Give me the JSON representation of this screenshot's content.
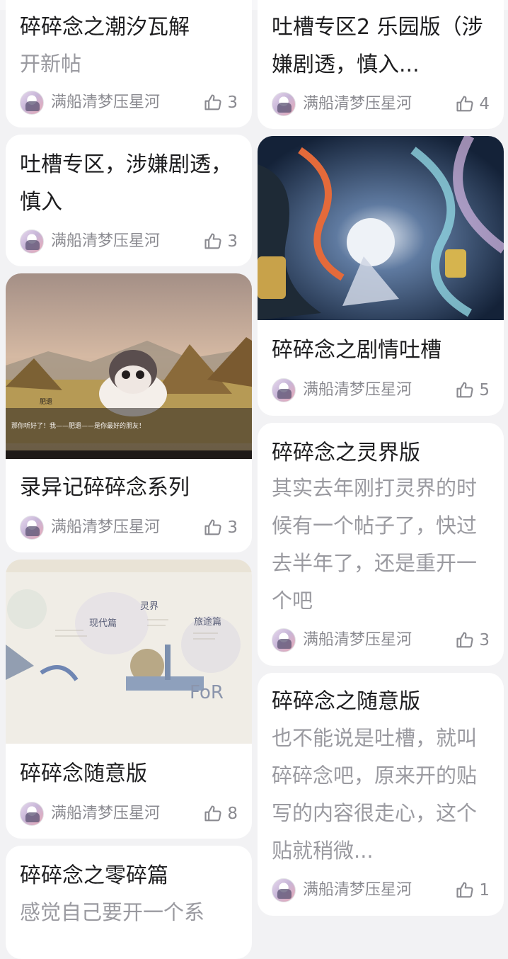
{
  "feed": {
    "cards": [
      {
        "title": "碎碎念之潮汐瓦解",
        "body": "开新帖",
        "author": "满船清梦压星河",
        "likes": "3"
      },
      {
        "title": "吐槽专区2 乐园版（涉嫌剧透，慎入...",
        "body": "",
        "author": "满船清梦压星河",
        "likes": "4"
      },
      {
        "title": "吐槽专区，涉嫌剧透，慎入",
        "body": "",
        "author": "满船清梦压星河",
        "likes": "3"
      },
      {
        "title": "碎碎念之剧情吐槽",
        "body": "",
        "author": "满船清梦压星河",
        "likes": "5",
        "image": "fantasy-artwork"
      },
      {
        "title": "录异记碎碎念系列",
        "body": "",
        "author": "满船清梦压星河",
        "likes": "3",
        "image": "game-screenshot",
        "image_caption_name": "肥遗",
        "image_caption_text": "那你听好了！我——肥遗——是你最好的朋友！"
      },
      {
        "title": "碎碎念之灵界版",
        "body": "其实去年刚打灵界的时候有一个帖子了，快过去半年了，还是重开一个吧",
        "author": "满船清梦压星河",
        "likes": "3"
      },
      {
        "title": "碎碎念随意版",
        "body": "",
        "author": "满船清梦压星河",
        "likes": "8",
        "image": "map-screenshot",
        "image_labels": [
          "现代篇",
          "灵界",
          "旅途篇",
          "FoR"
        ]
      },
      {
        "title": "碎碎念之随意版",
        "body": "也不能说是吐槽，就叫碎碎念吧，原来开的贴写的内容很走心，这个贴就稍微...",
        "author": "满船清梦压星河",
        "likes": "1"
      },
      {
        "title": "碎碎念之零碎篇",
        "body": "感觉自己要开一个系",
        "author": "",
        "likes": ""
      }
    ]
  },
  "icons": {
    "like": "thumbs-up-icon",
    "avatar": "user-avatar"
  }
}
